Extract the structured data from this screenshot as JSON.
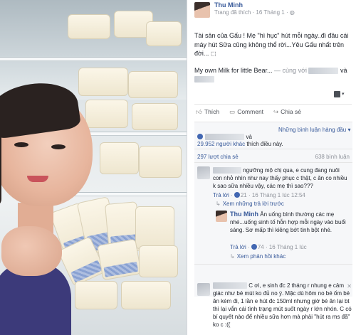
{
  "post": {
    "author": "Thu Minh",
    "page_label": "Trang đã thích",
    "date": "16 Tháng 1",
    "status_line1": "Tài sản của Gấu ! Mẹ \"hì hục\" hút mỗi ngày..đi đâu cái máy hút Sữa cũng không thể rời...Yêu Gấu nhất trên đời...",
    "status_line2": "My own Milk for little Bear...",
    "with_text": " — cùng với",
    "with_suffix": "và",
    "emoji": "⬚"
  },
  "actions": {
    "like": "Thích",
    "comment": "Comment",
    "share": "Chia sẻ",
    "like_icon": "thumbs-up-icon",
    "comment_icon": "speech-bubble-icon",
    "share_icon": "share-arrow-icon"
  },
  "stats": {
    "sort_label": "Những bình luận hàng đầu",
    "likes_and": "và",
    "likes_count": "29.952 người khác",
    "likes_suffix": "thích điều này.",
    "shares": "297 lượt chia sẻ",
    "comments": "638 bình luận"
  },
  "comments": [
    {
      "author_hidden": true,
      "text": "ngưỡng mộ chị qua, e cung đang nuôi con nhỏ nhìn như nay thấy phục c thật, c ăn co nhiều k sao sữa nhiều vậy, các mẹ thì sao???",
      "reply": "Trả lời",
      "likes": "21",
      "date": "16 Tháng 1 lúc 12:54",
      "view_prev": "Xem những trả lời trước"
    },
    {
      "author": "Thu Minh",
      "text": "Ăn uống bình thường các mẹ nhé...uống sinh tố hỗn hợp mỗi ngày vào buổi sáng. Sơ mấp thì kiêng bớt tinh bột nhé.",
      "reply": "Trả lời",
      "likes": "74",
      "date": "16 Tháng 1 lúc",
      "view_replies": "Xem phản hồi khác"
    },
    {
      "author_hidden": true,
      "text": "C ơi, e sinh đc 2 tháng r nhung e cảm giác như bé mút ko đủ no ý. Mặc dù hôm no bé ốm bé ăn kém đi, 1 lần e hút đc 150ml nhưng giờ bé ăn lại bt thì lại vắn cái tình trạng mút suốt ngày r lớn nhón. C có bí quyết nào để nhiều sữa hơn mà phải \"hút ra ms đã\" ko c :(("
    }
  ]
}
